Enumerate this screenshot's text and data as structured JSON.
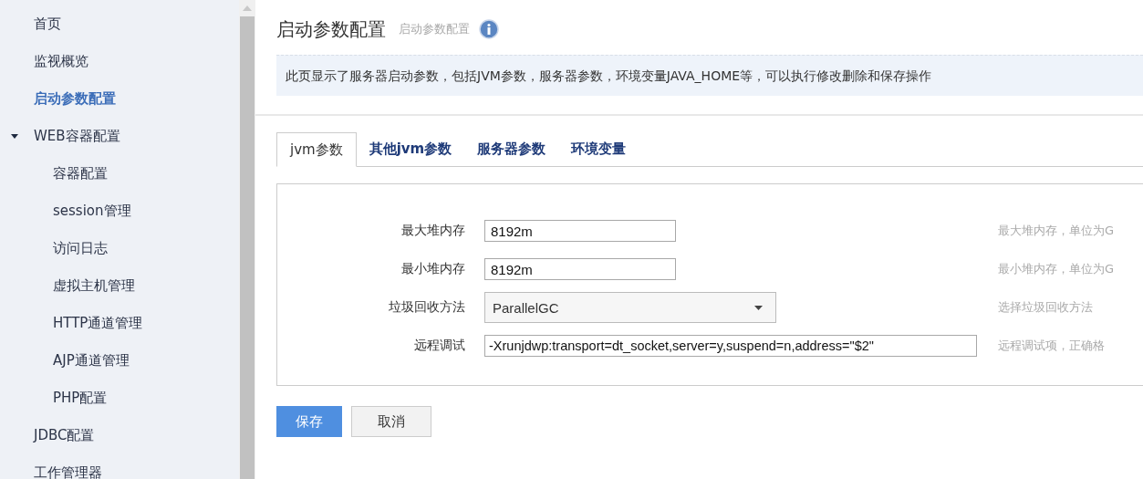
{
  "sidebar": {
    "items": [
      {
        "label": "首页",
        "selected": false
      },
      {
        "label": "监视概览",
        "selected": false
      },
      {
        "label": "启动参数配置",
        "selected": true
      },
      {
        "label": "WEB容器配置",
        "selected": false,
        "expanded": true,
        "children": [
          {
            "label": "容器配置",
            "selected": false
          },
          {
            "label": "session管理",
            "selected": false
          },
          {
            "label": "访问日志",
            "selected": false
          },
          {
            "label": "虚拟主机管理",
            "selected": false
          },
          {
            "label": "HTTP通道管理",
            "selected": false
          },
          {
            "label": "AJP通道管理",
            "selected": false
          },
          {
            "label": "PHP配置",
            "selected": false
          }
        ]
      },
      {
        "label": "JDBC配置",
        "selected": false
      },
      {
        "label": "工作管理器",
        "selected": false
      }
    ]
  },
  "page": {
    "title": "启动参数配置",
    "subtitle": "启动参数配置",
    "info": "此页显示了服务器启动参数，包括JVM参数，服务器参数，环境变量JAVA_HOME等，可以执行修改删除和保存操作"
  },
  "tabs": [
    {
      "label": "jvm参数",
      "selected": true
    },
    {
      "label": "其他jvm参数",
      "selected": false
    },
    {
      "label": "服务器参数",
      "selected": false
    },
    {
      "label": "环境变量",
      "selected": false
    }
  ],
  "form": {
    "fields": [
      {
        "kind": "text",
        "label": "最大堆内存",
        "value": "8192m",
        "hint": "最大堆内存，单位为G"
      },
      {
        "kind": "text",
        "label": "最小堆内存",
        "value": "8192m",
        "hint": "最小堆内存，单位为G"
      },
      {
        "kind": "select",
        "label": "垃圾回收方法",
        "value": "ParallelGC",
        "hint": "选择垃圾回收方法"
      },
      {
        "kind": "wide",
        "label": "远程调试",
        "value": "-Xrunjdwp:transport=dt_socket,server=y,suspend=n,address=\"$2\"",
        "hint": "远程调试项，正确格"
      }
    ]
  },
  "buttons": [
    {
      "label": "保存",
      "kind": "primary"
    },
    {
      "label": "取消",
      "kind": "default"
    }
  ]
}
